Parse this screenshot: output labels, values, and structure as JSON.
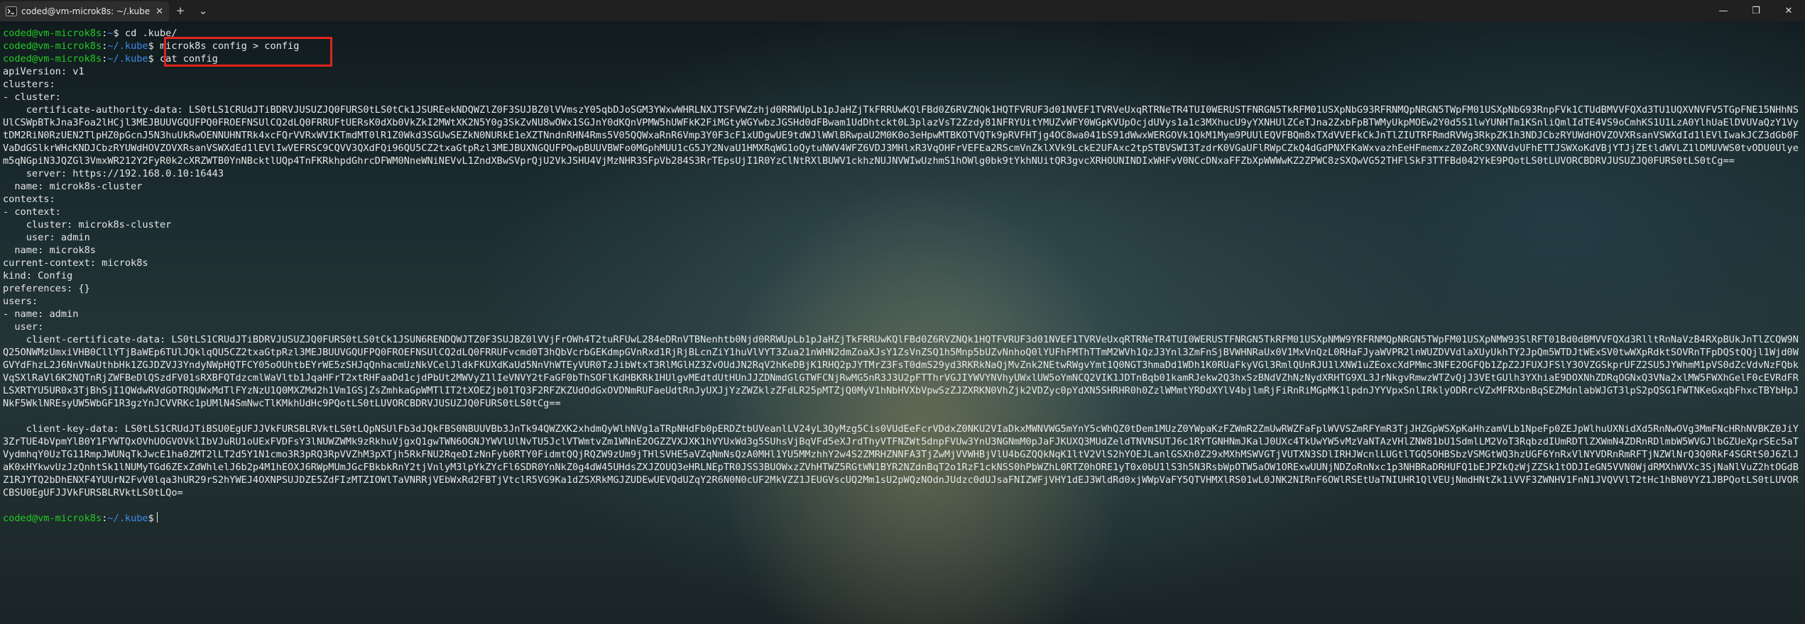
{
  "tab": {
    "title": "coded@vm-microk8s: ~/.kube",
    "close": "✕",
    "new_tab": "+",
    "dropdown": "⌄"
  },
  "window": {
    "minimize": "—",
    "maximize": "❐",
    "close": "✕"
  },
  "prompt": {
    "user_host": "coded@vm-microk8s",
    "sep": ":",
    "path_home": "~",
    "path_kube": "~/.kube",
    "suffix": "$"
  },
  "commands": {
    "c1": " cd .kube/",
    "c2": " microk8s config > config",
    "c3": " cat config"
  },
  "config": {
    "l01": "apiVersion: v1",
    "l02": "clusters:",
    "l03": "- cluster:",
    "cad": "    certificate-authority-data: LS0tLS1CRUdJTiBDRVJUSUZJQ0FURS0tLS0tCk1JSUREekNDQWZlZ0F3SUJBZ0lVVmszY05qbDJoSGM3YWxwWHRLNXJTSFVWZzhjd0RRWUpLb1pJaHZjTkFRRUwKQlFBd0Z6RVZNQk1HQTFVRUF3d01NVEF1TVRVeUxqRTRNeTR4TUI0WERUSTFNRGN5TkRFM01USXpNbG93RFRNMQpNRGN5TWpFM01USXpNbG93RnpFVk1CTUdBMVVFQXd3TU1UQXVNVFV5TGpFNE15NHhNSUlCSWpBTkJna3Foa2lHCjl3MEJBUUVGQUFPQ0FROEFNSUlCQ2dLQ0FRRUFtUERsK0dXb0VkZkI2MWtXK2N5Y0g3SkZvNU8wOWx1SGJnY0dKQnVPMW5hUWFkK2FiMGtyWGYwbzJGSHd0dFBwam1UdDhtckt0L3plazVsT2Zzdy81NFRYUitYMUZvWFY0WGpKVUpOcjdUVys1a1c3MXhucU9yYXNHUlZCeTJna2ZxbFpBTWMyUkpMOEw2Y0d5S1lwYUNHTm1KSnliQmlIdTE4VS9oCmhKS1U1LzA0YlhUaElDVUVaQzY1VytDM2RiN0RzUEN2TlpHZ0pGcnJ5N3huUkRwOENNUHNTRk4xcFQrVVRxWVIKTmdMT0lR1Z0Wkd3SGUwSEZkN0NURkE1eXZTNndnRHN4Rms5V05QQWxaRnR6Vmp3Y0F3cF1xUDgwUE9tdWJlWWlBRwpaU2M0K0o3eHpwMTBKOTVQTk9pRVFHTjg4OC8wa041bS91dWwxWERGOVk1QkM1Mym9PUUlEQVFBQm8xTXdVVEFkCkJnTlZIUTRFRmdRVWg3RkpZK1h3NDJCbzRYUWdHOVZOVXRsanVSWXdId1lEVlIwakJCZ3dGb0FVaDdGSlkrWHcKNDJCbzRYUWdHOVZOVXRsanVSWXdEd1lEVlIwVEFRSC9CQVV3QXdFQi96QU5CZ2txaGtpRzl3MEJBUXNGQUFPQwpBUUVBWFo0MGphMUU1cG5JY2NvaU1HMXRqWG1oQytuNWV4WFZ6VDJ3MHlxR3VqOHFrVEFEa2RScmVnZklXVk9LckE2UFAxc2tpSTBVSWI3TzdrK0VGaUFlRWpCZkQ4dGdPNXFKaWxvazhEeHFmemxzZ0ZoRC9XNVdvUFhETTJSWXoKdVBjYTJjZEtldWVLZ1lDMUVWS0tvODU0Ulyem5qNGpiN3JQZGl3VmxWR212Y2FyR0k2cXRZWTB0YnNBcktlUQp4TnFKRkhpdGhrcDFWM0NneWNiNEVvL1ZndXBwSVprQjU2VkJSHU4VjMzNHR3SFpVb284S3RrTEpsUjI1R0YzClNtRXlBUWV1ckhzNUJNVWIwUzhmS1hOWlg0bk9tYkhNUitQR3gvcXRHOUNINDIxWHFvV0NCcDNxaFFZbXpWWWwKZ2ZPWC8zSXQwVG52THFlSkF3TTFBd042YkE9PQotLS0tLUVORCBDRVJUSUZJQ0FURS0tLS0tCg==",
    "server": "    server: https://192.168.0.10:16443",
    "cname": "  name: microk8s-cluster",
    "l07": "contexts:",
    "l08": "- context:",
    "l09": "    cluster: microk8s-cluster",
    "l10": "    user: admin",
    "l11": "  name: microk8s",
    "l12": "current-context: microk8s",
    "l13": "kind: Config",
    "l14": "preferences: {}",
    "l15": "users:",
    "l16": "- name: admin",
    "l17": "  user:",
    "ccd": "    client-certificate-data: LS0tLS1CRUdJTiBDRVJUSUZJQ0FURS0tLS0tCk1JSUN6RENDQWJTZ0F3SUJBZ0lVVjFrOWh4T2tuRFUwL284eDRnVTBNenhtb0Njd0RRWUpLb1pJaHZjTkFRRUwKQlFBd0Z6RVZNQk1HQTFVRUF3d01NVEF1TVRVeUxqRTRNeTR4TUI0WERUSTFNRGN5TkRFM01USXpNMW9YRFRNMQpNRGN5TWpFM01USXpNMW93SlRFT01Bd0dBMVVFQXd3RlltRnNaVzB4RXpBUkJnTlZCQW9NQ25ONWMzUmxiVHB0CllYTjBaWEp6TUlJQklqQU5CZ2txaGtpRzl3MEJBUUVGQUFPQ0FROEFNSUlCQ2dLQ0FRRUFvcmd0T3hQbVcrbGEKdmpGVnRxd1RjRjBLcnZiY1huVlVYT3Zua21nWHN2dmZoaXJsY1ZsVnZSQ1h5Mnp5bUZvNnhoQ0lYUFhFMThTTmM2WVh1QzJ3Ynl3ZmFnSjBVWHNRaUx0V1MxVnQzL0RHaFJyaWVPR2lnWUZDVVdlaXUyUkhTY2JpQm5WTDJtWExSV0twWXpRdktSOVRnTFpDQStQQjl1Wjd0WGVYdFhzL2J6NnVNaUthbHk1ZGJDZVJ3YndyNWpHQTFCY05oOUhtbEYrWE5zSHJqQnhacmUzNkVCelJldkFKUXdKaUd5NnVhWTEyVUR0TzJibWtxT3RlMGlHZ3ZvOUdJN2RqV2hKeDBjK1RHQ2pJYTMrZ3FsT0dmS29yd3RKRkNaQjMvZnk2NEtwRWgvYmt1Q0NGT3hmaDd1WDh1K0RUaFkyVGl3RmlQUnRJU1lXNW1uZEoxcXdPMmc3NFE2OGFQb1ZpZ2JFUXJFSlY3OVZGSkprUFZ2SU5JYWhmM1pVS0dZcVdvNzFQbkVqSXlRaVl6K2NQTnRjZWFBeDlQSzdFV01sRXBFQTdzcmlWaVltb1JqaHFrT2xtRHFaaDd1cjdPbUt2MWVyZ1lIeVNVY2tFaGF0bThSOFlKdHBKRk1HUlgvMEdtdUtHUnJJZDNmdGlGTWFCNjRwMG5nR3J3U2pFTThrVGJIYWVYNVhyUWxlUW5oYmNCQ2VIK1JDTnBqb01kamRJekw2Q3hxSzBNdVZhNzNydXRHTG9XL3JrNkgvRmwzWTZvQjJ3VEtGUlh3YXhiaE9DOXNhZDRqOGNxQ3VNa2xlMW5FWXhGelF0cEVRdFRLSXRTYU5UR0x3TjBhSjI1QWdwRVdGOTRQUWxMdTlFYzNzU1Q0MXZMd2h1Vm1GSjZsZmhkaGpWMTlIT2tXOEZjb01TQ3F2RFZKZUdOdGxOVDNmRUFaeUdtRnJyUXJjYzZWZklzZFdLR25pMTZjQ0MyV1hNbHVXbVpwSzZJZXRKN0VhZjk2VDZyc0pYdXN5SHRHR0h0ZzlWMmtYRDdXYlV4bjlmRjFiRnRiMGpMK1lpdnJYYVpxSnlIRklyODRrcVZxMFRXbnBqSEZMdnlabWJGT3lpS2pQSG1FWTNKeGxqbFhxcTBYbHpJNkF5WklNREsyUW5WbGF1R3gzYnJCVVRKc1pUMlN4SmNwcTlKMkhUdHc9PQotLS0tLUVORCBDRVJUSUZJQ0FURS0tLS0tCg==",
    "ckd": "    client-key-data: LS0tLS1CRUdJTiBSU0EgUFJJVkFURSBLRVktLS0tLQpNSUlFb3dJQkFBS0NBUUVBb3JnTk94QWZXK2xhdmQyWlhNVg1aTRpNHdFb0pERDZtbUVeanlLV24yL3QyMzg5Cis0VUdEeFcrVDdxZ0NKU2VIaDkxMWNVWG5mYnY5cWhQZ0tDem1MUzZ0YWpaKzFZWmR2ZmUwRWZFaFplWVVSZmRFYmR3TjJHZGpWSXpKaHhzamVLb1NpeFp0ZEJpWlhuUXNidXd5RnNwOVg3MmFNcHRhNVBKZ0JiY3ZrTUE4bVpmYlB0Y1FYWTQxOVhUOGVOVklIbVJuRU1oUExFVDFsY3lNUWZWMk9zRkhuVjgxQ1gwTWN6OGNJYWVlUlNvTU5JclVTWmtvZm1WNnE2OGZZVXJXK1hVYUxWd3g5SUhsVjBqVFd5eXJrdThyVTFNZWt5dnpFVUw3YnU3NGNmM0pJaFJKUXQ3MUdZeldTNVNSUTJ6c1RYTGNHNmJKalJ0UXc4TkUwYW5vMzVaNTAzVHlZNW81bU1SdmlLM2VoT3RqbzdIUmRDTlZXWmN4ZDRnRDlmbW5WVGJlbGZUeXprSEc5aTVydmhqY0UzTG11RmpJWUNqTkJwcE1ha0ZMT2lLT2d5Y1N1cmo3R3pRQ3RpVVZhM3pXTjh5RkFNU2RqeDIzNnFyb0RTY0FidmtQQjRQZW9zUm9jTHlSVHE5aVZqNmNsQzA0MHl1YU5MMzhhY2w4S2ZMRHZNNFA3TjZwMjVVWHBjVlU4bGZQQkNqK1ltV2VlS2hYOEJLanlGSXh0Z29xMXhMSWVGTjVUTXN3SDlIRHJWcnlLUGtlTGQ5OHBSbzVSMGtWQ3hzUGF6YnRxVlNYVDRnRmRFTjNZWlNrQ3Q0RkF4SGRtS0J6ZlJaK0xHYkwvUzJzQnhtSk1lNUMyTGd6ZExZdWhlelJ6b2p4M1hEOXJ6RWpMUmJGcFBkbkRnY2tjVnlyM3lpYkZYcFl6SDR0YnNkZ0g4dW45UHdsZXJZOUQ3eHRLNEpTR0JSS3BUOWxzZVhHTWZ5RGtWN1BYR2NZdnBqT2o1RzF1ckNSS0hPbWZhL0RTZ0hORE1yT0x0bU1lS3h5N3RsbWpOTW5aOW1ORExwUUNjNDZoRnNxc1p3NHBRaDRHUFQ1bEJPZkQzWjZZSk1tODJIeGN5VVN0WjdRMXhWVXc3SjNaNlVuZ2htOGdBZ1RJYTQ2bDhENXF4YUUrN2FvV0lqa3hUR29rS2hYWEJ4OXNPSUJDZE5ZdFIzMTZIOWlTaVNRRjVEbWxRd2FBTjVtclR5VG9Ka1dZSXRkMGJZUDEwUEVQdUZqY2R6N0N0cUF2MkVZZ1JEUGVscUQ2Mm1sU2pWQzNOdnJUdzc0dUJsaFNIZWFjVHY1dEJ3WldRd0xjWWpVaFY5QTVHMXlRS01wL0JNK2NIRnF6OWlRSEtUaTNIUHR1QlVEUjNmdHNtZk1iVVF3ZWNHV1FnN1JVQVVlT2tHc1hBN0VYZ1JBPQotLS0tLUVORCBSU0EgUFJJVkFURSBLRVktLS0tLQo="
  }
}
